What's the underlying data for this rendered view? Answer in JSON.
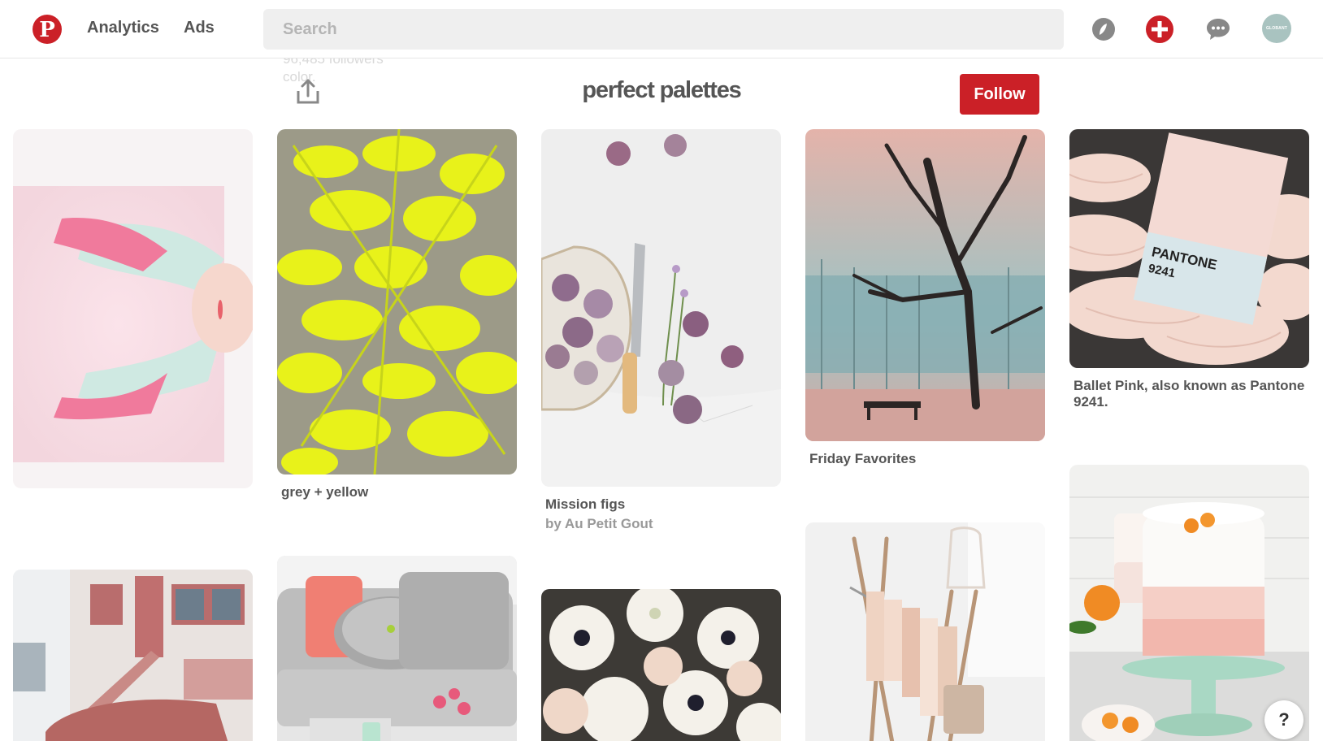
{
  "header": {
    "logo_letter": "P",
    "nav": {
      "analytics": "Analytics",
      "ads": "Ads"
    },
    "search_placeholder": "Search",
    "icons": [
      "explore-icon",
      "add-pin-icon",
      "messages-icon"
    ],
    "avatar_text": "GLOBANT"
  },
  "board": {
    "title": "perfect palettes",
    "follow_label": "Follow",
    "share_icon": "share-icon",
    "ghost_line1": "96,485 followers",
    "ghost_line2": "color."
  },
  "pins": [
    {
      "title": "",
      "sub": ""
    },
    {
      "title": "grey + yellow",
      "sub": ""
    },
    {
      "title": "Mission figs",
      "sub": "by Au Petit Gout"
    },
    {
      "title": "Friday Favorites",
      "sub": ""
    },
    {
      "title": "Ballet Pink, also known as Pantone 9241.",
      "sub": ""
    },
    {
      "title": "",
      "sub": ""
    },
    {
      "title": "",
      "sub": ""
    },
    {
      "title": "",
      "sub": ""
    },
    {
      "title": "",
      "sub": ""
    },
    {
      "title": "",
      "sub": ""
    }
  ],
  "pantone_card": {
    "brand": "PANTONE",
    "code": "9241"
  },
  "help_label": "?",
  "colors": {
    "brand_red": "#cb2027",
    "search_bg": "#efefef"
  }
}
